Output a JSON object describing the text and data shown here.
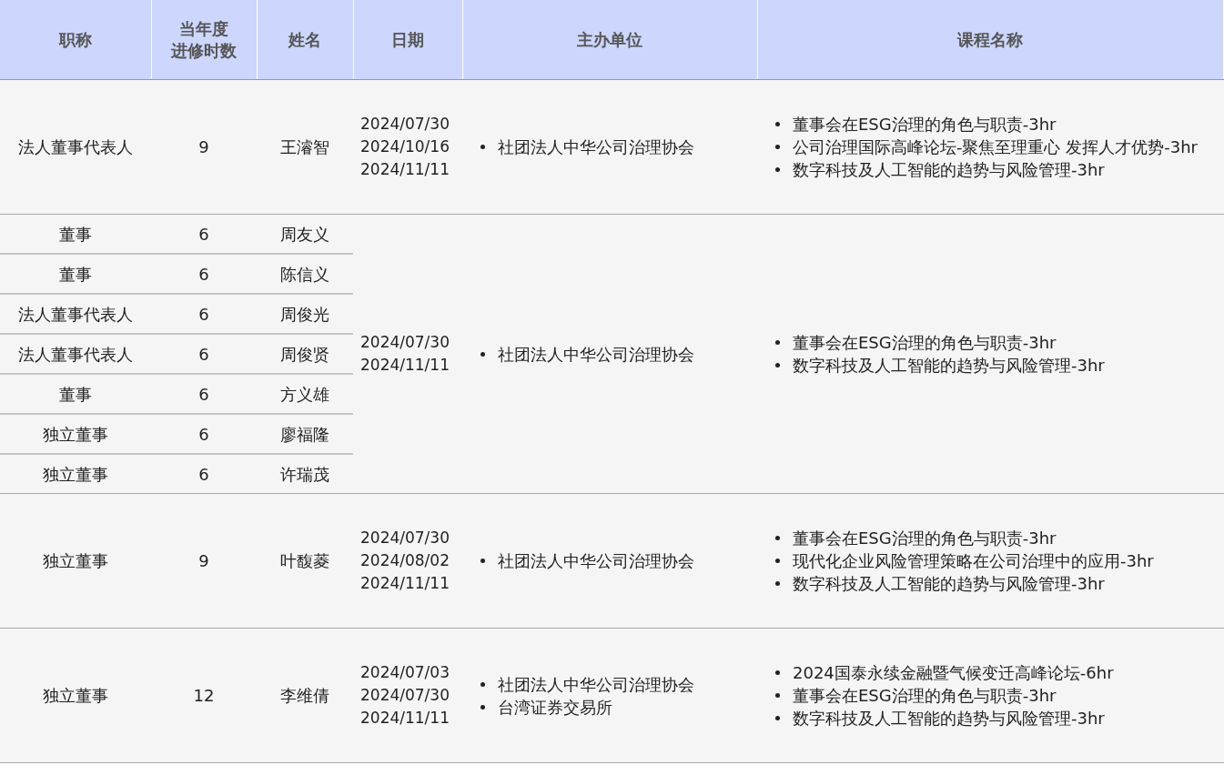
{
  "table": {
    "columns": [
      [
        "职称"
      ],
      [
        "当年度",
        "进修时数"
      ],
      [
        "姓名"
      ],
      [
        "日期"
      ],
      [
        "主办单位"
      ],
      [
        "课程名称"
      ]
    ],
    "groups": [
      {
        "members": [
          {
            "title": "法人董事代表人",
            "hours": "9",
            "name": "王濬智"
          }
        ],
        "dates": [
          "2024/07/30",
          "2024/10/16",
          "2024/11/11"
        ],
        "hosts": [
          "社团法人中华公司治理协会"
        ],
        "courses": [
          "董事会在ESG治理的角色与职责-3hr",
          "公司治理国际高峰论坛-聚焦至理重心  发挥人才优势-3hr",
          "数字科技及人工智能的趋势与风险管理-3hr"
        ]
      },
      {
        "members": [
          {
            "title": "董事",
            "hours": "6",
            "name": "周友义"
          },
          {
            "title": "董事",
            "hours": "6",
            "name": "陈信义"
          },
          {
            "title": "法人董事代表人",
            "hours": "6",
            "name": "周俊光"
          },
          {
            "title": "法人董事代表人",
            "hours": "6",
            "name": "周俊贤"
          },
          {
            "title": "董事",
            "hours": "6",
            "name": "方义雄"
          },
          {
            "title": "独立董事",
            "hours": "6",
            "name": "廖福隆"
          },
          {
            "title": "独立董事",
            "hours": "6",
            "name": "许瑞茂"
          }
        ],
        "dates": [
          "2024/07/30",
          "2024/11/11"
        ],
        "hosts": [
          "社团法人中华公司治理协会"
        ],
        "courses": [
          "董事会在ESG治理的角色与职责-3hr",
          "数字科技及人工智能的趋势与风险管理-3hr"
        ]
      },
      {
        "members": [
          {
            "title": "独立董事",
            "hours": "9",
            "name": "叶馥菱"
          }
        ],
        "dates": [
          "2024/07/30",
          "2024/08/02",
          "2024/11/11"
        ],
        "hosts": [
          "社团法人中华公司治理协会"
        ],
        "courses": [
          "董事会在ESG治理的角色与职责-3hr",
          "现代化企业风险管理策略在公司治理中的应用-3hr",
          "数字科技及人工智能的趋势与风险管理-3hr"
        ]
      },
      {
        "members": [
          {
            "title": "独立董事",
            "hours": "12",
            "name": "李维倩"
          }
        ],
        "dates": [
          "2024/07/03",
          "2024/07/30",
          "2024/11/11"
        ],
        "hosts": [
          "社团法人中华公司治理协会",
          "台湾证券交易所"
        ],
        "courses": [
          "2024国泰永续金融暨气候变迁高峰论坛-6hr",
          "董事会在ESG治理的角色与职责-3hr",
          "数字科技及人工智能的趋势与风险管理-3hr"
        ]
      }
    ]
  }
}
